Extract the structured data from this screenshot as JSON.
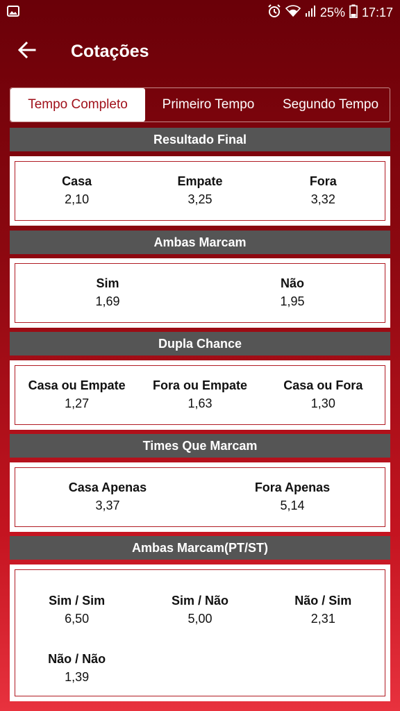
{
  "status": {
    "battery": "25%",
    "time": "17:17"
  },
  "header": {
    "title": "Cotações"
  },
  "tabs": [
    {
      "label": "Tempo Completo",
      "active": true
    },
    {
      "label": "Primeiro Tempo",
      "active": false
    },
    {
      "label": "Segundo Tempo",
      "active": false
    }
  ],
  "sections": {
    "resultado_final": {
      "title": "Resultado Final",
      "items": [
        {
          "label": "Casa",
          "value": "2,10"
        },
        {
          "label": "Empate",
          "value": "3,25"
        },
        {
          "label": "Fora",
          "value": "3,32"
        }
      ]
    },
    "ambas_marcam": {
      "title": "Ambas Marcam",
      "items": [
        {
          "label": "Sim",
          "value": "1,69"
        },
        {
          "label": "Não",
          "value": "1,95"
        }
      ]
    },
    "dupla_chance": {
      "title": "Dupla Chance",
      "items": [
        {
          "label": "Casa ou Empate",
          "value": "1,27"
        },
        {
          "label": "Fora ou Empate",
          "value": "1,63"
        },
        {
          "label": "Casa ou Fora",
          "value": "1,30"
        }
      ]
    },
    "times_que_marcam": {
      "title": "Times Que Marcam",
      "items": [
        {
          "label": "Casa Apenas",
          "value": "3,37"
        },
        {
          "label": "Fora Apenas",
          "value": "5,14"
        }
      ]
    },
    "ambas_marcam_pt_st": {
      "title": "Ambas Marcam(PT/ST)",
      "items": [
        {
          "label": "Sim / Sim",
          "value": "6,50"
        },
        {
          "label": "Sim / Não",
          "value": "5,00"
        },
        {
          "label": "Não / Sim",
          "value": "2,31"
        },
        {
          "label": "Não / Não",
          "value": "1,39"
        }
      ]
    }
  },
  "colors": {
    "accent": "#a0101a",
    "header_gray": "#555555",
    "gradient_top": "#6a0008",
    "gradient_bottom": "#e8323e"
  }
}
